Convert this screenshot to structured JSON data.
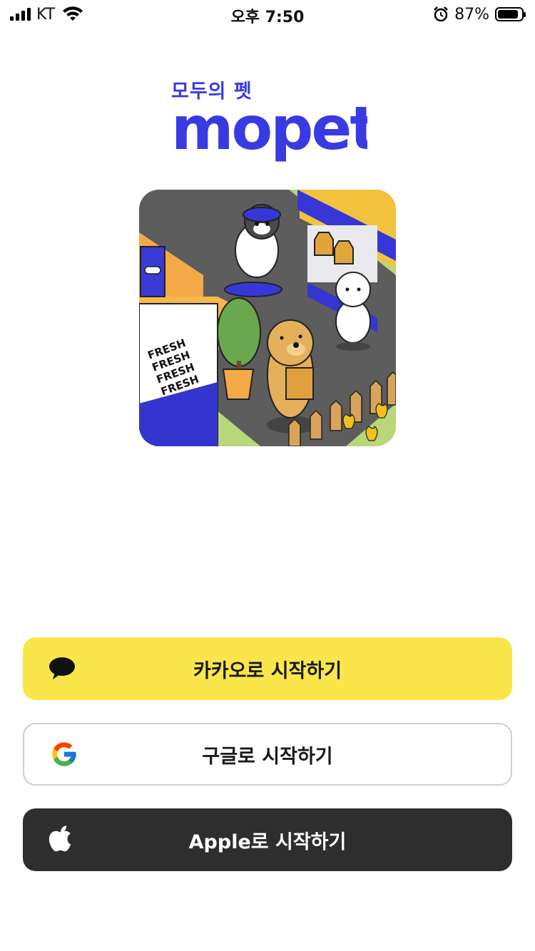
{
  "status_bar": {
    "carrier": "KT",
    "time": "오후 7:50",
    "battery_percent": "87%",
    "battery_level": 0.87,
    "icons": [
      "signal-icon",
      "wifi-icon",
      "alarm-icon",
      "battery-icon"
    ]
  },
  "brand": {
    "tagline": "모두의 펫",
    "name": "mopet",
    "color": "#3a3ae3"
  },
  "hero": {
    "sign_text": [
      "FRESH",
      "FRESH",
      "FRESH",
      "FRESH"
    ]
  },
  "buttons": {
    "kakao": {
      "label": "카카오로 시작하기",
      "icon": "kakao-chat-icon",
      "color": "#fae64b"
    },
    "google": {
      "label": "구글로 시작하기",
      "icon": "google-g-icon",
      "color": "#ffffff"
    },
    "apple": {
      "label": "Apple로 시작하기",
      "icon": "apple-logo-icon",
      "color": "#2e2e2e"
    }
  }
}
